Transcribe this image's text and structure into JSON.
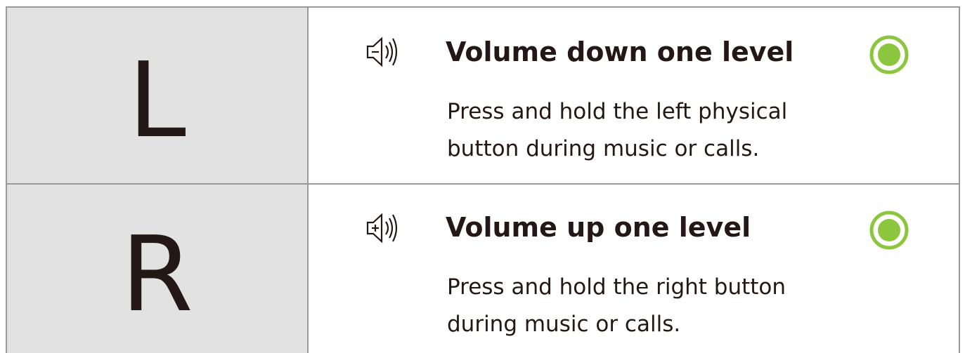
{
  "colors": {
    "text": "#231815",
    "key_cell_background": "#e2e2e2",
    "border": "#9a9a9a",
    "indicator_green": "#8cc63f"
  },
  "rows": [
    {
      "key": "L",
      "icon": "volume-down-icon",
      "title": "Volume down one level",
      "description": "Press and hold the left physical button during music or calls.",
      "indicator": "green-indicator-icon"
    },
    {
      "key": "R",
      "icon": "volume-up-icon",
      "title": "Volume up one level",
      "description": "Press and hold the right button during music or calls.",
      "indicator": "green-indicator-icon"
    }
  ]
}
